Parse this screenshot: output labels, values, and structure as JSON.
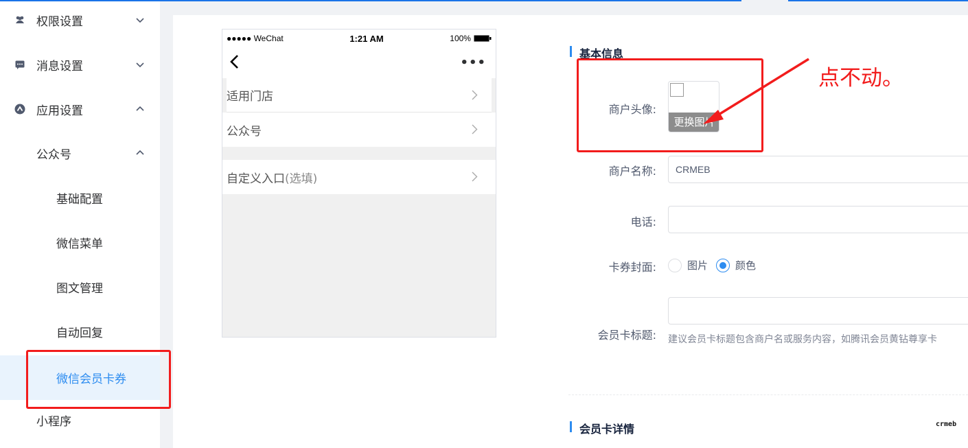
{
  "sidebar": {
    "items": [
      {
        "label": "权限设置",
        "icon": "users-icon",
        "arrow": "chevron-down"
      },
      {
        "label": "消息设置",
        "icon": "message-icon",
        "arrow": "chevron-down"
      },
      {
        "label": "应用设置",
        "icon": "app-icon",
        "arrow": "chevron-up"
      },
      {
        "label": "公众号",
        "arrow": "chevron-up"
      },
      {
        "label": "基础配置"
      },
      {
        "label": "微信菜单"
      },
      {
        "label": "图文管理"
      },
      {
        "label": "自动回复"
      },
      {
        "label": "微信会员卡券",
        "active": true
      },
      {
        "label": "小程序"
      }
    ]
  },
  "phone": {
    "carrier": "●●●●● WeChat",
    "time": "1:21 AM",
    "battery": "100%",
    "rows": [
      {
        "label": "适用门店"
      },
      {
        "label": "公众号"
      },
      {
        "label": "自定义入口",
        "hint": "(选填)"
      }
    ]
  },
  "form": {
    "basic_title": "基本信息",
    "avatar_label": "商户头像:",
    "avatar_change": "更换图片",
    "name_label": "商户名称:",
    "name_value": "CRMEB",
    "phone_label": "电话:",
    "phone_value": "",
    "cover_label": "卡券封面:",
    "cover_options": [
      {
        "label": "图片",
        "selected": false
      },
      {
        "label": "颜色",
        "selected": true
      }
    ],
    "card_title_label": "会员卡标题:",
    "card_title_value": "",
    "card_title_help": "建议会员卡标题包含商户名或服务内容，如腾讯会员黄钻尊享卡",
    "detail_title": "会员卡详情"
  },
  "annotation": {
    "text": "点不动。"
  },
  "logo": {
    "text": "crmeb"
  },
  "colors": {
    "accent": "#2d8cf0",
    "annotation_red": "#f21c1c",
    "active_bg": "#e9f3fd"
  }
}
